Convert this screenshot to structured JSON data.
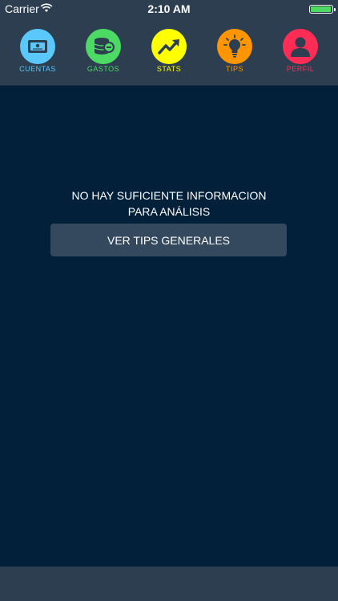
{
  "status_bar": {
    "carrier": "Carrier",
    "time": "2:10 AM",
    "battery_level": 1.0
  },
  "tabs": [
    {
      "label": "CUENTAS",
      "icon": "wallet-icon",
      "color": "#5ac8fa",
      "label_color": "#5ac8fa"
    },
    {
      "label": "GASTOS",
      "icon": "coins-icon",
      "color": "#4cd964",
      "label_color": "#4cd964"
    },
    {
      "label": "STATS",
      "icon": "trending-up-icon",
      "color": "#ffff00",
      "label_color": "#ffff00"
    },
    {
      "label": "TIPS",
      "icon": "lightbulb-icon",
      "color": "#ff9500",
      "label_color": "#ff9500"
    },
    {
      "label": "PERFIL",
      "icon": "user-icon",
      "color": "#ff2d55",
      "label_color": "#ff2d55"
    }
  ],
  "main": {
    "message_line1": "NO HAY SUFICIENTE INFORMACION",
    "message_line2": "PARA ANÁLISIS",
    "button_label": "VER TIPS GENERALES"
  }
}
